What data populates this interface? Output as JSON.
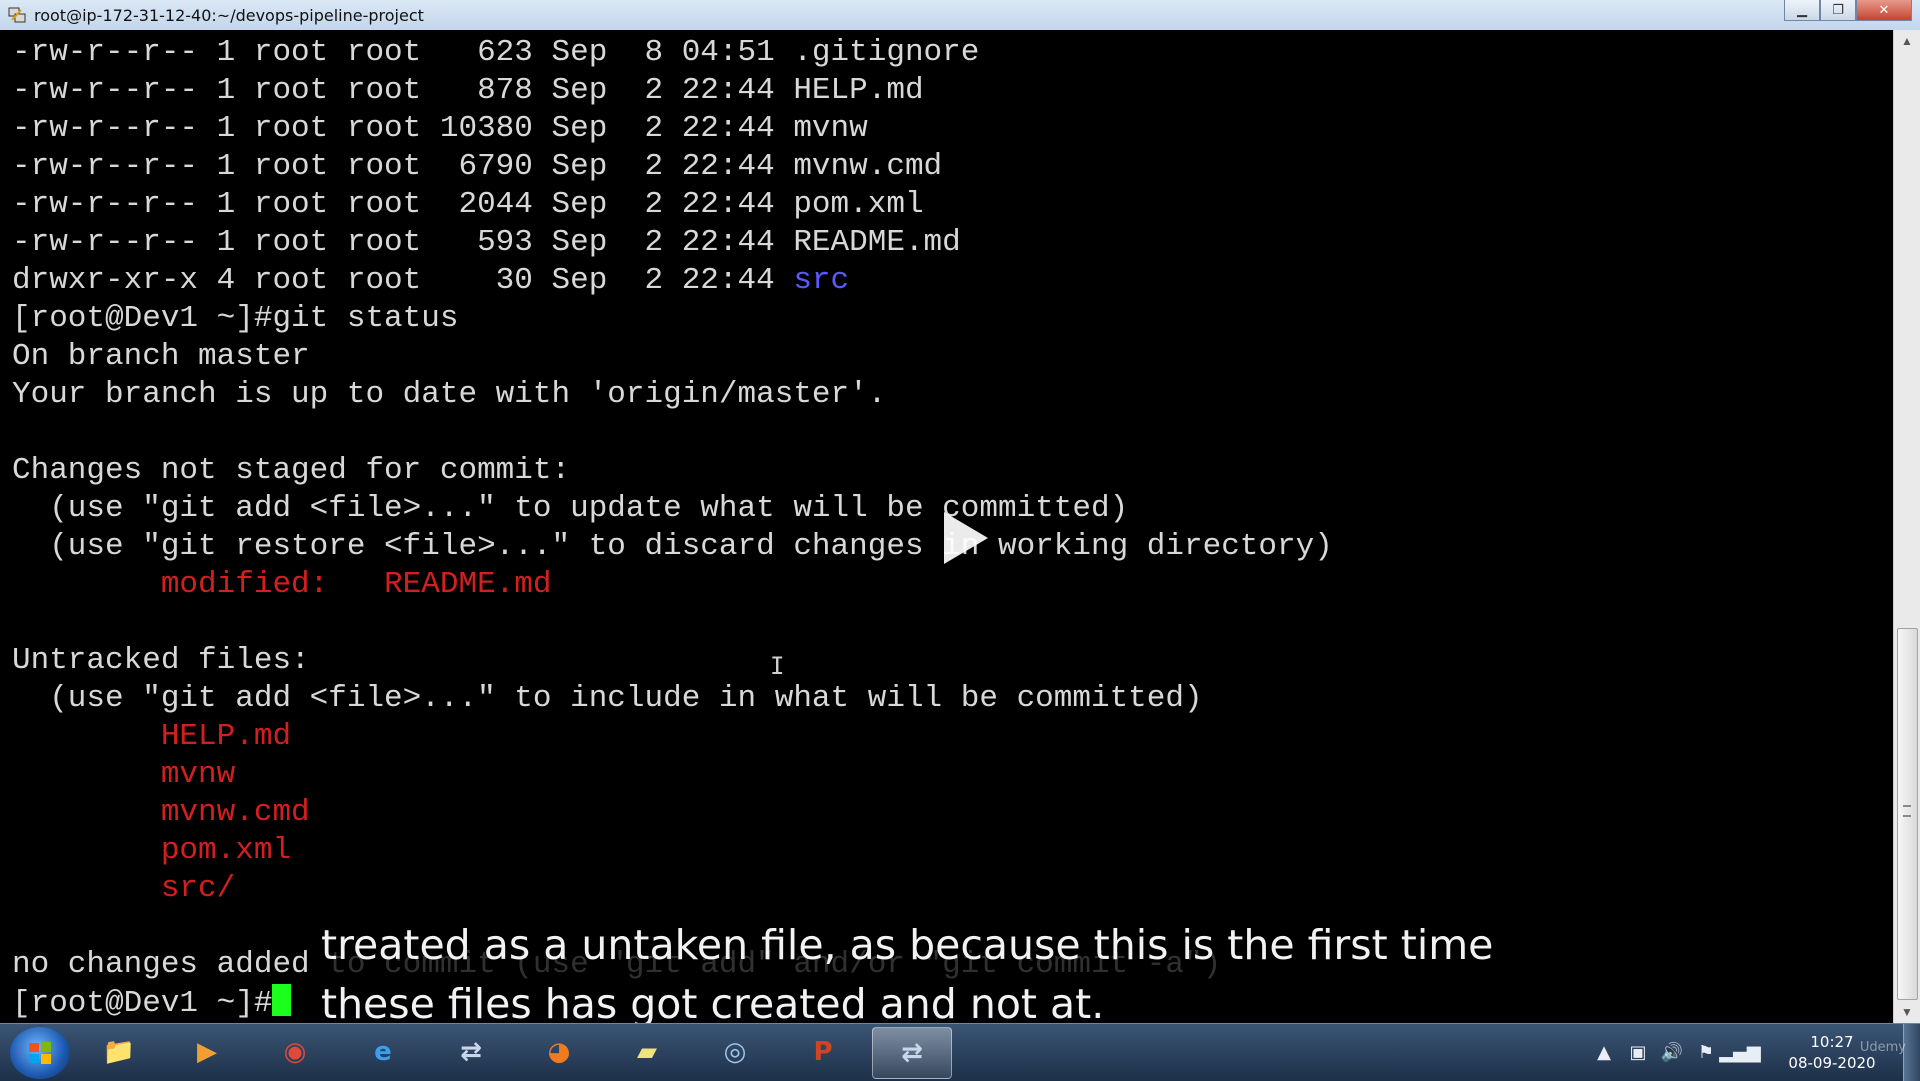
{
  "window": {
    "title": "root@ip-172-31-12-40:~/devops-pipeline-project",
    "min_glyph": "▁",
    "max_glyph": "❐",
    "close_glyph": "✕"
  },
  "terminal": {
    "lines": [
      {
        "segments": [
          {
            "text": "-rw-r--r-- 1 root root   623 Sep  8 04:51 .gitignore",
            "color": "default"
          }
        ]
      },
      {
        "segments": [
          {
            "text": "-rw-r--r-- 1 root root   878 Sep  2 22:44 HELP.md",
            "color": "default"
          }
        ]
      },
      {
        "segments": [
          {
            "text": "-rw-r--r-- 1 root root 10380 Sep  2 22:44 mvnw",
            "color": "default"
          }
        ]
      },
      {
        "segments": [
          {
            "text": "-rw-r--r-- 1 root root  6790 Sep  2 22:44 mvnw.cmd",
            "color": "default"
          }
        ]
      },
      {
        "segments": [
          {
            "text": "-rw-r--r-- 1 root root  2044 Sep  2 22:44 pom.xml",
            "color": "default"
          }
        ]
      },
      {
        "segments": [
          {
            "text": "-rw-r--r-- 1 root root   593 Sep  2 22:44 README.md",
            "color": "default"
          }
        ]
      },
      {
        "segments": [
          {
            "text": "drwxr-xr-x 4 root root    30 Sep  2 22:44 ",
            "color": "default"
          },
          {
            "text": "src",
            "color": "blue"
          }
        ]
      },
      {
        "segments": [
          {
            "text": "[root@Dev1 ~]#git status",
            "color": "default"
          }
        ]
      },
      {
        "segments": [
          {
            "text": "On branch master",
            "color": "default"
          }
        ]
      },
      {
        "segments": [
          {
            "text": "Your branch is up to date with 'origin/master'.",
            "color": "default"
          }
        ]
      },
      {
        "segments": [
          {
            "text": "",
            "color": "default"
          }
        ]
      },
      {
        "segments": [
          {
            "text": "Changes not staged for commit:",
            "color": "default"
          }
        ]
      },
      {
        "segments": [
          {
            "text": "  (use \"git add <file>...\" to update what will be committed)",
            "color": "default"
          }
        ]
      },
      {
        "segments": [
          {
            "text": "  (use \"git restore <file>...\" to discard changes in working directory)",
            "color": "default"
          }
        ]
      },
      {
        "segments": [
          {
            "text": "        ",
            "color": "default"
          },
          {
            "text": "modified:   README.md",
            "color": "red"
          }
        ]
      },
      {
        "segments": [
          {
            "text": "",
            "color": "default"
          }
        ]
      },
      {
        "segments": [
          {
            "text": "Untracked files:",
            "color": "default"
          }
        ]
      },
      {
        "segments": [
          {
            "text": "  (use \"git add <file>...\" to include in what will be committed)",
            "color": "default"
          }
        ]
      },
      {
        "segments": [
          {
            "text": "        ",
            "color": "default"
          },
          {
            "text": "HELP.md",
            "color": "red"
          }
        ]
      },
      {
        "segments": [
          {
            "text": "        ",
            "color": "default"
          },
          {
            "text": "mvnw",
            "color": "red"
          }
        ]
      },
      {
        "segments": [
          {
            "text": "        ",
            "color": "default"
          },
          {
            "text": "mvnw.cmd",
            "color": "red"
          }
        ]
      },
      {
        "segments": [
          {
            "text": "        ",
            "color": "default"
          },
          {
            "text": "pom.xml",
            "color": "red"
          }
        ]
      },
      {
        "segments": [
          {
            "text": "        ",
            "color": "default"
          },
          {
            "text": "src/",
            "color": "red"
          }
        ]
      },
      {
        "segments": [
          {
            "text": "",
            "color": "default"
          }
        ]
      },
      {
        "segments": [
          {
            "text": "no changes added to commit (use \"git add\" and/or \"git commit -a\")",
            "color": "default"
          }
        ]
      }
    ],
    "prompt": "[root@Dev1 ~]#",
    "colors": {
      "default": "#d8d8d8",
      "blue": "#5a5aff",
      "red": "#d21f1f",
      "cursor": "#1cff1c"
    }
  },
  "scrollbar": {
    "up_glyph": "▲",
    "down_glyph": "▼"
  },
  "video": {
    "subtitle_lines": [
      "treated as a untaken file, as because this is the first time",
      "these files has got created and not at."
    ],
    "watermark": "Udemy"
  },
  "taskbar": {
    "apps": [
      {
        "name": "file-explorer",
        "glyph": "📁",
        "color": "#e8c15a",
        "active": false
      },
      {
        "name": "media-player",
        "glyph": "▶",
        "color": "#f0a030",
        "active": false
      },
      {
        "name": "chrome",
        "glyph": "◉",
        "color": "#e04a3a",
        "active": false
      },
      {
        "name": "internet-explorer",
        "glyph": "e",
        "color": "#3aa0ee",
        "active": false
      },
      {
        "name": "putty",
        "glyph": "⇄",
        "color": "#c9d6ea",
        "active": false
      },
      {
        "name": "firefox",
        "glyph": "◕",
        "color": "#f07a20",
        "active": false
      },
      {
        "name": "sticky-notes",
        "glyph": "▰",
        "color": "#f2e27a",
        "active": false
      },
      {
        "name": "recorder",
        "glyph": "◎",
        "color": "#9fc5e8",
        "active": false
      },
      {
        "name": "powerpoint",
        "glyph": "P",
        "color": "#d04423",
        "active": false
      },
      {
        "name": "putty-active",
        "glyph": "⇄",
        "color": "#c9d6ea",
        "active": true
      }
    ],
    "tray": [
      {
        "name": "show-hidden-icons",
        "glyph": "▲"
      },
      {
        "name": "network-adapter-icon",
        "glyph": "▣"
      },
      {
        "name": "volume-icon",
        "glyph": "🔊"
      },
      {
        "name": "action-center-flag-icon",
        "glyph": "⚑"
      },
      {
        "name": "signal-icon",
        "glyph": "▂▄▆"
      }
    ],
    "clock_time": "10:27",
    "clock_date": "08-09-2020"
  }
}
